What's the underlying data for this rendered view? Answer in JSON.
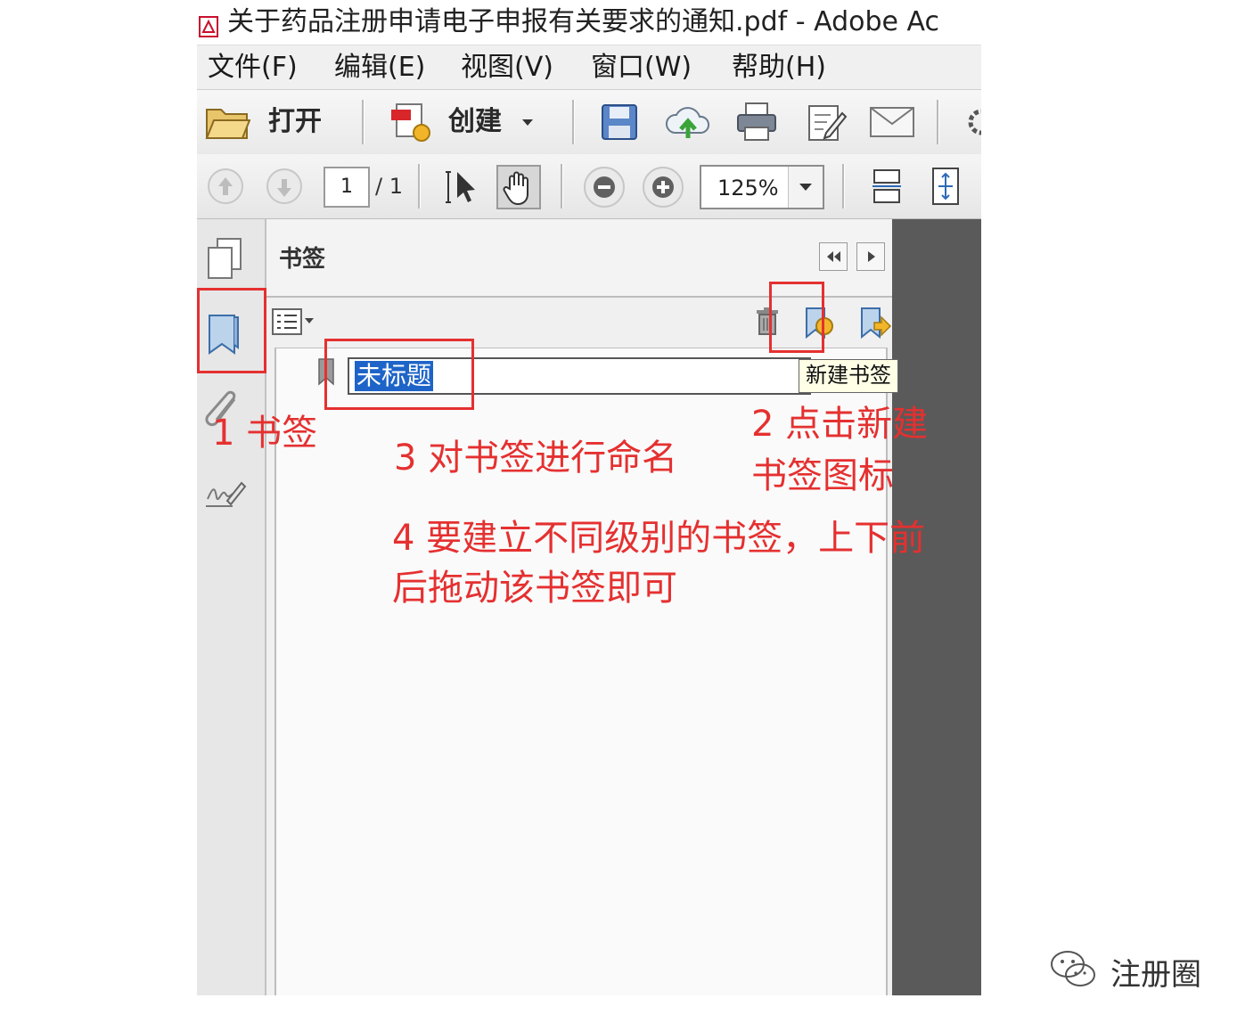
{
  "window": {
    "title": "关于药品注册申请电子申报有关要求的通知.pdf - Adobe Ac"
  },
  "menubar": {
    "items": [
      "文件(F)",
      "编辑(E)",
      "视图(V)",
      "窗口(W)",
      "帮助(H)"
    ]
  },
  "toolbar": {
    "open_label": "打开",
    "create_label": "创建"
  },
  "navbar": {
    "page_current": "1",
    "page_total": "/ 1",
    "zoom": "125%"
  },
  "bookmark_panel": {
    "title": "书签",
    "new_bookmark_text": "未标题",
    "tooltip": "新建书签"
  },
  "annotations": {
    "step1": "1 书签",
    "step2_line1": "2 点击新建",
    "step2_line2": "书签图标",
    "step3": "3 对书签进行命名",
    "step4_line1": "4 要建立不同级别的书签，上下前",
    "step4_line2": "后拖动该书签即可"
  },
  "watermark": {
    "text": "注册圈"
  },
  "colors": {
    "annotation_red": "#e53030",
    "selection_blue": "#1e64c8",
    "doc_background": "#5a5a5a"
  }
}
